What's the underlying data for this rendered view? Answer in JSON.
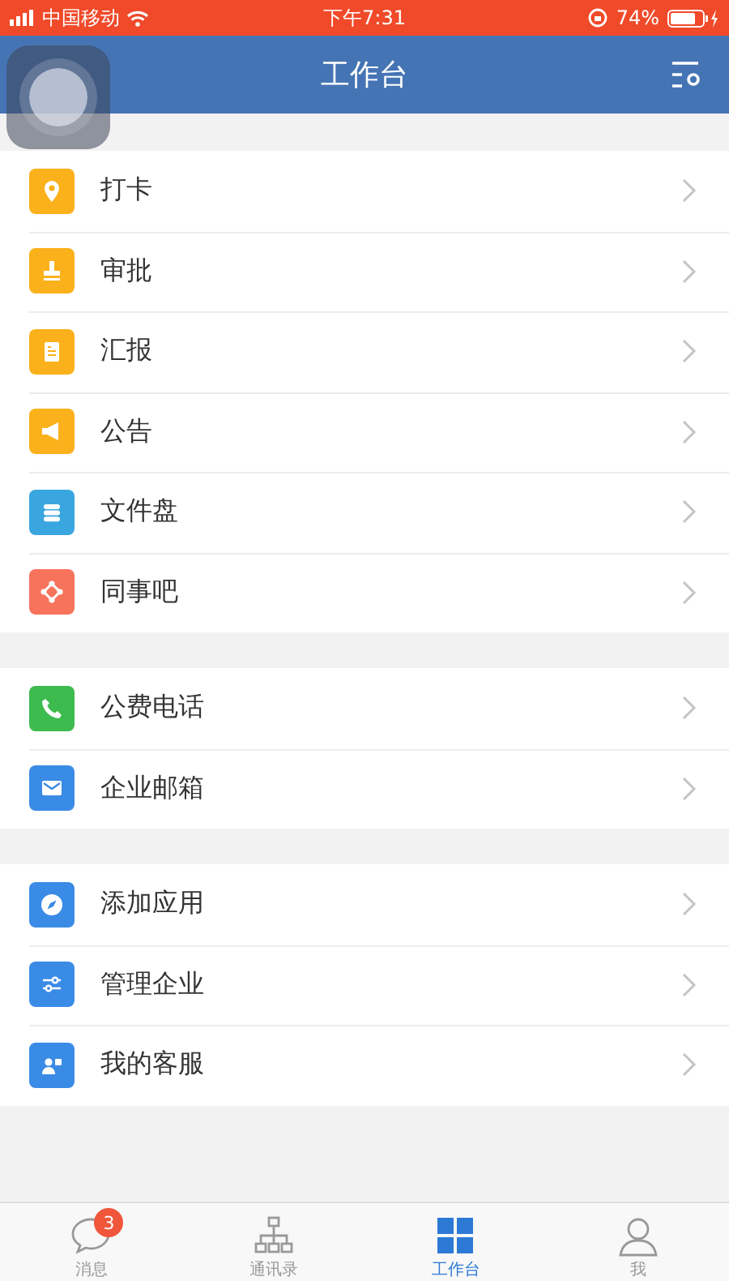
{
  "status_bar": {
    "carrier": "中国移动",
    "time": "下午7:31",
    "battery": "74%"
  },
  "header": {
    "title": "工作台"
  },
  "groups": [
    {
      "items": [
        {
          "label": "打卡",
          "color": "#fbb11b"
        },
        {
          "label": "审批",
          "color": "#fbb11b"
        },
        {
          "label": "汇报",
          "color": "#fbb11b"
        },
        {
          "label": "公告",
          "color": "#fbb11b"
        },
        {
          "label": "文件盘",
          "color": "#3aa6e0"
        },
        {
          "label": "同事吧",
          "color": "#f7735c"
        }
      ]
    },
    {
      "items": [
        {
          "label": "公费电话",
          "color": "#3dbb4e"
        },
        {
          "label": "企业邮箱",
          "color": "#3a8be6"
        }
      ]
    },
    {
      "items": [
        {
          "label": "添加应用",
          "color": "#3a8be6"
        },
        {
          "label": "管理企业",
          "color": "#3a8be6"
        },
        {
          "label": "我的客服",
          "color": "#3a8be6"
        }
      ]
    }
  ],
  "tab_bar": [
    {
      "label": "消息",
      "badge": "3",
      "selected": false
    },
    {
      "label": "通讯录",
      "selected": false
    },
    {
      "label": "工作台",
      "selected": true
    },
    {
      "label": "我",
      "selected": false
    }
  ]
}
